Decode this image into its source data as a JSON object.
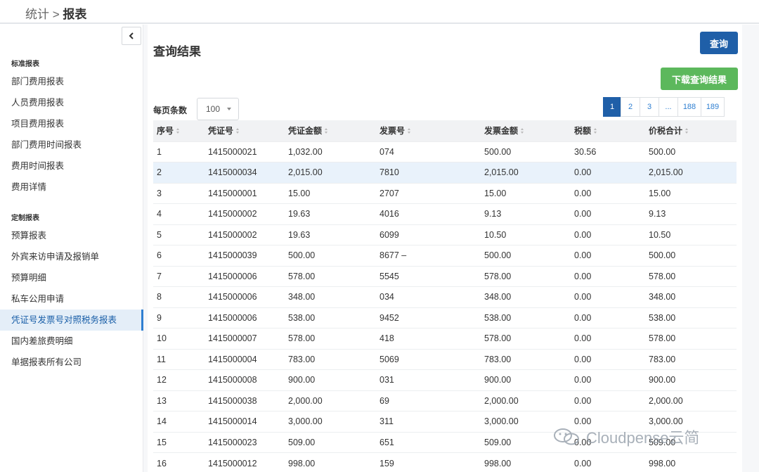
{
  "breadcrumb": {
    "parent": "统计",
    "separator": ">",
    "current": "报表"
  },
  "sidebar": {
    "sections": [
      {
        "title": "标准报表",
        "top": 0
      },
      {
        "title": "定制报表",
        "top": 0
      }
    ],
    "standard_items": [
      "部门费用报表",
      "人员费用报表",
      "项目费用报表",
      "部门费用时间报表",
      "费用时间报表",
      "费用详情"
    ],
    "custom_items": [
      "预算报表",
      "外宾来访申请及报销单",
      "预算明细",
      "私车公用申请",
      "凭证号发票号对照税务报表",
      "国内差旅费明细",
      "单据报表所有公司"
    ],
    "active_item": "凭证号发票号对照税务报表"
  },
  "main": {
    "title": "查询结果",
    "query_button": "查询",
    "download_button": "下载查询结果",
    "page_size_label": "每页条数",
    "page_size_value": "100",
    "pagination": [
      "1",
      "2",
      "3",
      "...",
      "188",
      "189"
    ],
    "active_page": "1"
  },
  "table": {
    "columns": [
      "序号",
      "凭证号",
      "凭证金额",
      "发票号",
      "发票金额",
      "税额",
      "价税合计"
    ],
    "rows": [
      [
        "1",
        "1415000021",
        "1,032.00",
        "074",
        "500.00",
        "30.56",
        "500.00"
      ],
      [
        "2",
        "1415000034",
        "2,015.00",
        "7810",
        "2,015.00",
        "0.00",
        "2,015.00"
      ],
      [
        "3",
        "1415000001",
        "15.00",
        "2707",
        "15.00",
        "0.00",
        "15.00"
      ],
      [
        "4",
        "1415000002",
        "19.63",
        "4016",
        "9.13",
        "0.00",
        "9.13"
      ],
      [
        "5",
        "1415000002",
        "19.63",
        "6099",
        "10.50",
        "0.00",
        "10.50"
      ],
      [
        "6",
        "1415000039",
        "500.00",
        "8677 –",
        "500.00",
        "0.00",
        "500.00"
      ],
      [
        "7",
        "1415000006",
        "578.00",
        "5545",
        "578.00",
        "0.00",
        "578.00"
      ],
      [
        "8",
        "1415000006",
        "348.00",
        "034",
        "348.00",
        "0.00",
        "348.00"
      ],
      [
        "9",
        "1415000006",
        "538.00",
        "9452",
        "538.00",
        "0.00",
        "538.00"
      ],
      [
        "10",
        "1415000007",
        "578.00",
        "418",
        "578.00",
        "0.00",
        "578.00"
      ],
      [
        "11",
        "1415000004",
        "783.00",
        "5069",
        "783.00",
        "0.00",
        "783.00"
      ],
      [
        "12",
        "1415000008",
        "900.00",
        "031",
        "900.00",
        "0.00",
        "900.00"
      ],
      [
        "13",
        "1415000038",
        "2,000.00",
        "69",
        "2,000.00",
        "0.00",
        "2,000.00"
      ],
      [
        "14",
        "1415000014",
        "3,000.00",
        "311",
        "3,000.00",
        "0.00",
        "3,000.00"
      ],
      [
        "15",
        "1415000023",
        "509.00",
        "651",
        "509.00",
        "0.00",
        "509.00"
      ],
      [
        "16",
        "1415000012",
        "998.00",
        "159",
        "998.00",
        "0.00",
        "998.00"
      ]
    ],
    "highlighted_row": 1
  },
  "watermark": {
    "text": "Cloudpense云简",
    "icon": "wechat-icon"
  },
  "colors": {
    "primary": "#1f5fa8",
    "success": "#5cb85c",
    "active_bg": "#e4eef8",
    "row_highlight": "#e9f2fb"
  }
}
